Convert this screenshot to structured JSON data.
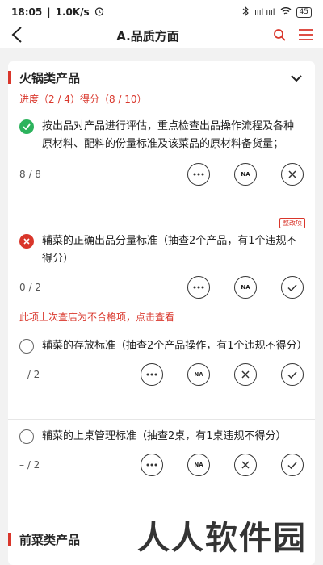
{
  "status_bar": {
    "time": "18:05",
    "speed": "1.0K/s",
    "signal": "ıııl ıııl",
    "battery": "45"
  },
  "nav": {
    "title": "A.品质方面"
  },
  "section1": {
    "title": "火锅类产品",
    "progress": "进度（2 / 4）得分（8 / 10）"
  },
  "items": [
    {
      "status": "pass",
      "text": "按出品对产品进行评估，重点检查出品操作流程及各种原材料、配料的份量标准及该菜品的原材料备货量；",
      "score": "8 / 8"
    },
    {
      "status": "fail",
      "tag": "整改项",
      "text": "辅菜的正确出品分量标准（抽查2个产品，有1个违规不得分）",
      "score": "0 / 2",
      "warning": "此项上次查店为不合格项，点击查看"
    },
    {
      "status": "none",
      "text": "辅菜的存放标准（抽查2个产品操作，有1个违规不得分）",
      "score": "– / 2"
    },
    {
      "status": "none",
      "text": "辅菜的上桌管理标准（抽查2桌，有1桌违规不得分）",
      "score": "– / 2"
    }
  ],
  "buttons": {
    "na": "NA"
  },
  "section2": {
    "title": "前菜类产品"
  },
  "watermark": "人人软件园"
}
